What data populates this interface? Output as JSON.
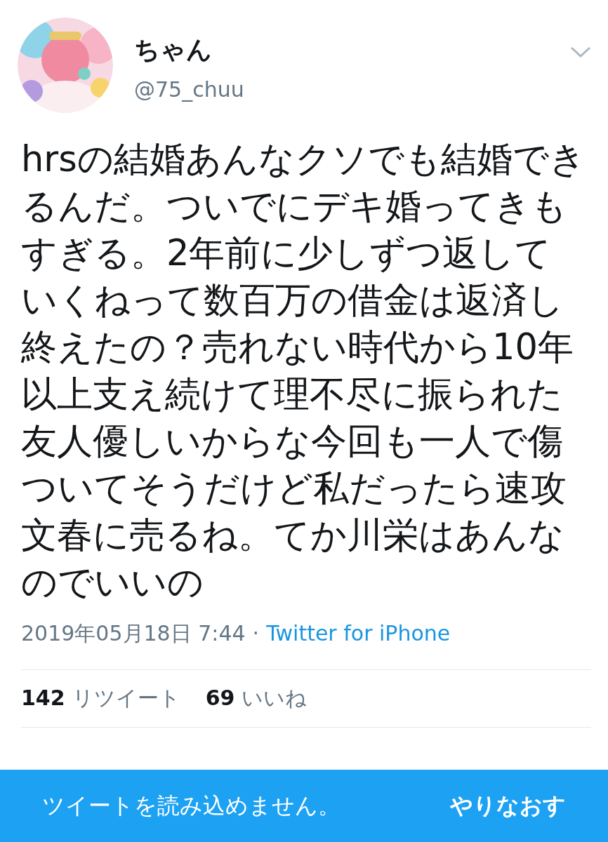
{
  "tweet": {
    "name": "ちゃん",
    "handle": "@75_chuu",
    "text": "hrsの結婚あんなクソでも結婚できるんだ。ついでにデキ婚ってきもすぎる。2年前に少しずつ返していくねって数百万の借金は返済し終えたの？売れない時代から10年以上支え続けて理不尽に振られた友人優しいからな今回も一人で傷ついてそうだけど私だったら速攻文春に売るね。てか川栄はあんなのでいいの",
    "timestamp": "2019年05月18日 7:44",
    "separator": "·",
    "source": "Twitter for iPhone",
    "stats": [
      {
        "count": "142",
        "label": "リツイート"
      },
      {
        "count": "69",
        "label": "いいね"
      }
    ]
  },
  "error_bar": {
    "message": "ツイートを読み込めません。",
    "action": "やりなおす"
  }
}
